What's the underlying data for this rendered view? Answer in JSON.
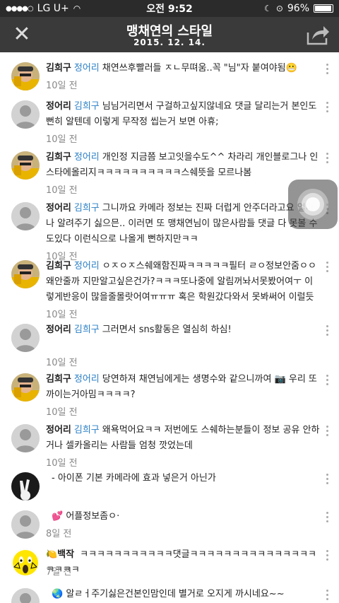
{
  "status": {
    "carrier": "LG U+",
    "time": "오전 9:52",
    "battery": "96%",
    "battery_fraction": 0.96
  },
  "header": {
    "title": "맹채연의 스타일",
    "date": "2015. 12. 14."
  },
  "comments": [
    {
      "author": "김희구",
      "mention": "정어리",
      "text": "채연쓰후빨러들 ㅈㄴ무뗘움..꼭 \"님\"자 붙여야됨😬",
      "time": "10일 전",
      "avatar": "photo-hat"
    },
    {
      "author": "정어리",
      "mention": "김희구",
      "text": "님님거리면서 구걸하고싶지않네요 댓글 달리는거 본인도 뻔히 알텐데 이렇게 무작정 씹는거 보면 아휴;",
      "time": "10일 전",
      "avatar": "default"
    },
    {
      "author": "김희구",
      "mention": "정어리",
      "text": "개인정 지금쯤 보고잇을수도^^ 차라리 개인블로그나 인스타에올리지ㅋㅋㅋㅋㅋㅋㅋㅋㅋㅋ스쉐뜻을 모르나봄",
      "time": "10일 전",
      "avatar": "photo-hat"
    },
    {
      "author": "정어리",
      "mention": "김희구",
      "text": "그니까요 카메라 정보는 진짜 더럽게 안주더라고요 얼마나 알려주기 싫으믄.. 이러면 또 맹채연님이 많은사람들 댓글 다 못볼 수도있다 이런식으로 나올게 뻔하지만ㅋㅋ",
      "time": "10일 전",
      "avatar": "default"
    },
    {
      "author": "김희구",
      "mention": "정어리",
      "text": "ㅇㅈㅇㅈ스쉐왜함진짜ㅋㅋㅋㅋㅋ필터 ㄹㅇ정보안줌ㅇㅇ왜안줄까 지만알고싶은건가?ㅋㅋㅋ또나중에 알림꺼놔서못봤어여ㅜ 이렇게반응이 많을줄몰랏어여ㅠㅠㅠ 혹은 학원갔다와서 못봐써어 이럴듯",
      "time": "10일 전",
      "avatar": "photo-hat"
    },
    {
      "author": "정어리",
      "mention": "김희구",
      "text": "그러면서 sns활동은 열심히 하심!",
      "time": "10일 전",
      "avatar": "default"
    },
    {
      "author": "김희구",
      "mention": "정어리",
      "text": "당연하져 채연님에게는 생명수와 같으니까여 📷 우리 또 까이는거아밈ㅋㅋㅋㅋ?",
      "time": "10일 전",
      "avatar": "photo-hat"
    },
    {
      "author": "정어리",
      "mention": "김희구",
      "text": "왜욕먹어요ㅋㅋ 저번에도 스쉐하는분들이 정보 공유 안하거나 셀카올리는 사람들 엄청 깟었는데",
      "time": "10일 전",
      "avatar": "default"
    },
    {
      "author": "",
      "mention": "",
      "text": "- 아이폰 기본 카메라에 효과 넣은거 아닌가",
      "time": "",
      "avatar": "photo-peace"
    },
    {
      "author": "",
      "mention": "",
      "text": "💕 어플정보좀ㅇ·",
      "time": "8일 전",
      "avatar": "default"
    },
    {
      "author": "🍋백작",
      "mention": "",
      "text": "ㅋㅋㅋㅋㅋㅋㅋㅋㅋㅋㅋ댓글ㅋㅋㅋㅋㅋㅋㅋㅋㅋㅋㅋㅋㅋㅋㅋㅋㅋㅋㅋ",
      "time": "7일 전",
      "avatar": "emoji-face"
    },
    {
      "author": "",
      "mention": "",
      "text": "🌏 알ㄹㅓ주기싫은건본인맘인데 별거로 오지게 까시네요~~",
      "time": "",
      "avatar": "default"
    }
  ]
}
